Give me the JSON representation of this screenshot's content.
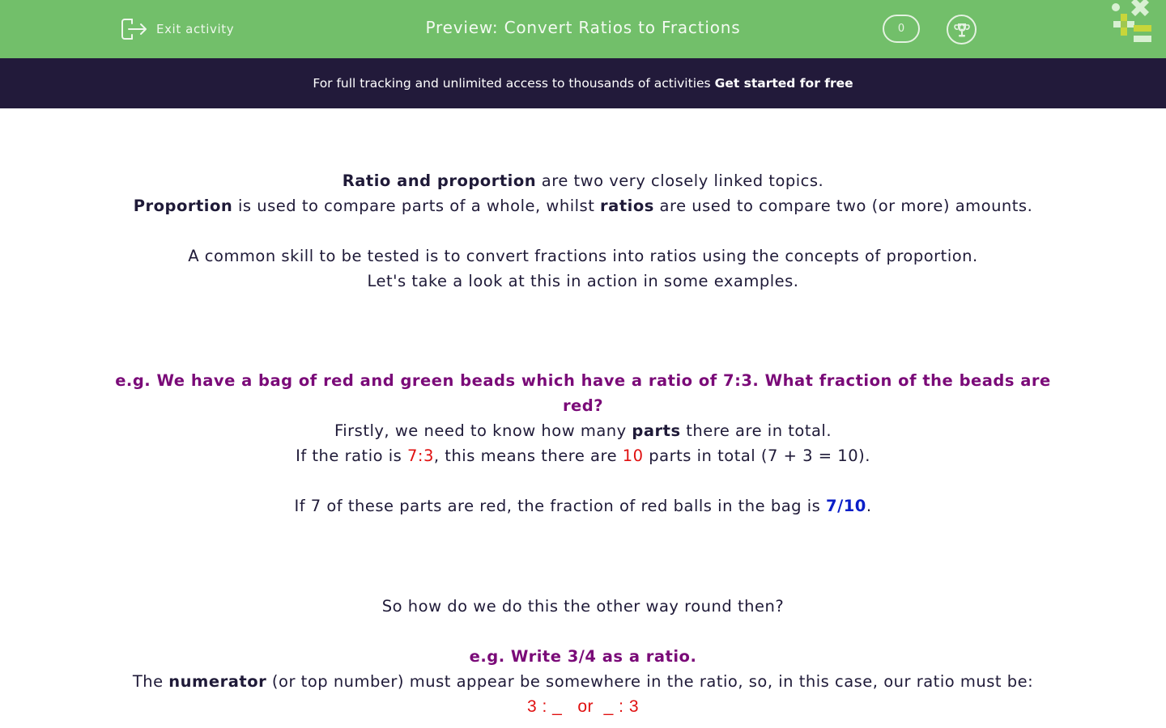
{
  "header": {
    "exit_label": "Exit activity",
    "title": "Preview: Convert Ratios to Fractions",
    "score": "0",
    "icons": {
      "exit": "exit-door-icon",
      "trophy": "trophy-icon",
      "logo": "math-symbols-logo"
    }
  },
  "banner": {
    "text": "For full tracking and unlimited access to thousands of activities",
    "cta": "Get started for free"
  },
  "content": {
    "intro": {
      "l1_bold": "Ratio and proportion",
      "l1_rest": " are two very closely linked topics.",
      "l2_bold1": "Proportion",
      "l2_mid": " is used to compare parts of a whole, whilst ",
      "l2_bold2": "ratios",
      "l2_rest": " are used to compare two (or more) amounts.",
      "l3": "A common skill to be tested is to convert fractions into ratios using the concepts of proportion.",
      "l4": "Let's take a look at this in action in some examples."
    },
    "example1": {
      "heading": "e.g. We have a bag of red and green beads which have a ratio of 7:3. What fraction of the beads are red?",
      "l1_a": "Firstly, we need to know how many ",
      "l1_bold": "parts",
      "l1_b": " there are in total.",
      "l2_a": "If the ratio is ",
      "l2_red1": "7:3",
      "l2_b": ", this means there are ",
      "l2_red2": "10",
      "l2_c": " parts in total (7 + 3 = 10).",
      "l3_a": "If 7 of these parts are red, the fraction of red balls in the bag is ",
      "l3_blue": "7/10",
      "l3_b": "."
    },
    "transition": "So how do we do this the other way round then?",
    "example2": {
      "heading": "e.g. Write 3/4 as a ratio.",
      "l1_a": "The ",
      "l1_bold": "numerator",
      "l1_b": " (or top number) must appear be somewhere in the ratio, so, in this case, our ratio must be:",
      "ratio_options": "3 : _   or  _ : 3"
    }
  },
  "colors": {
    "header_green": "#72bf6a",
    "banner_navy": "#221a3a",
    "heading_purple": "#7a0a78",
    "highlight_red": "#e01010",
    "answer_blue": "#0a1fc8"
  }
}
